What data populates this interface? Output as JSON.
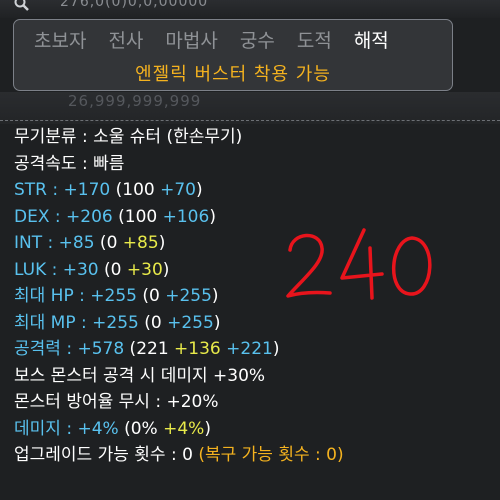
{
  "ghost_top": "276,0(0)0,0,00000",
  "ghost_mid": "26,999,999,999",
  "jobs": [
    "초보자",
    "전사",
    "마법사",
    "궁수",
    "도적",
    "해적"
  ],
  "active_job": "해적",
  "badge": "엔젤릭 버스터 착용 가능",
  "colors": {
    "cyan": "#59c1ee",
    "yellow": "#e8ea4a",
    "orange": "#f4b21f",
    "white": "#ffffff",
    "annotation_red": "#e8141c"
  },
  "stats": {
    "category": "무기분류 : 소울 슈터 (한손무기)",
    "speed": "공격속도 : 빠름",
    "str": {
      "label": "STR : +170",
      "open": " (100 ",
      "bonus": "+70",
      "close": ")"
    },
    "dex": {
      "label": "DEX : +206",
      "open": " (100 ",
      "bonus": "+106",
      "close": ")"
    },
    "int": {
      "label": "INT : +85",
      "open": " (0 ",
      "bonus": "+85",
      "close": ")"
    },
    "luk": {
      "label": "LUK : +30",
      "open": " (0 ",
      "bonus": "+30",
      "close": ")"
    },
    "hp": {
      "label": "최대 HP : +255",
      "open": " (0 ",
      "bonus": "+255",
      "close": ")"
    },
    "mp": {
      "label": "최대 MP : +255",
      "open": " (0 ",
      "bonus": "+255",
      "close": ")"
    },
    "atk": {
      "label": "공격력 : +578",
      "open": " (221 ",
      "bonus1": "+136",
      "bonus2": " +221",
      "close": ")"
    },
    "boss": "보스 몬스터 공격 시 데미지 +30%",
    "ignore": "몬스터 방어율 무시 : +20%",
    "dmg": {
      "label": "데미지 : +4%",
      "open": " (0% ",
      "bonus": "+4%",
      "close": ")"
    },
    "upgrade": {
      "label": "업그레이드 가능 횟수 : 0 ",
      "recover": "(복구 가능 횟수 : 0)"
    }
  },
  "annotation": "240"
}
